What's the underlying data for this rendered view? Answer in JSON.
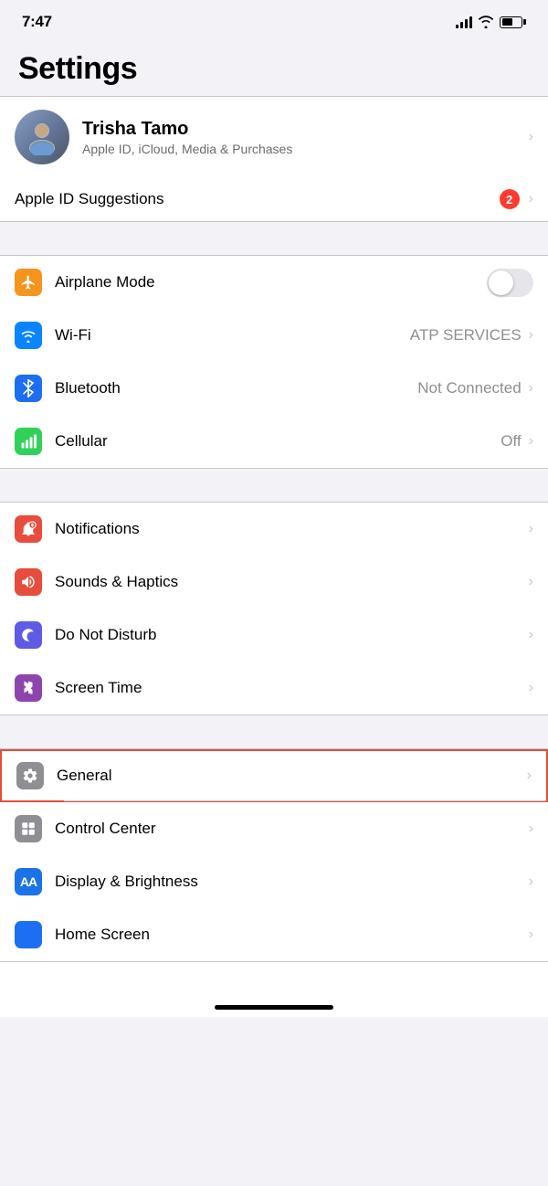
{
  "statusBar": {
    "time": "7:47",
    "batteryLevel": 55
  },
  "pageTitle": "Settings",
  "profile": {
    "name": "Trisha Tamo",
    "subtitle": "Apple ID, iCloud, Media & Purchases",
    "avatarEmoji": "👤"
  },
  "appleIdSuggestions": {
    "label": "Apple ID Suggestions",
    "badgeCount": "2"
  },
  "connectivity": [
    {
      "id": "airplane-mode",
      "label": "Airplane Mode",
      "iconBg": "bg-orange",
      "iconSymbol": "✈",
      "valueType": "toggle",
      "toggleOn": false
    },
    {
      "id": "wifi",
      "label": "Wi-Fi",
      "iconBg": "bg-blue",
      "iconSymbol": "wifi",
      "value": "ATP SERVICES",
      "valueType": "text"
    },
    {
      "id": "bluetooth",
      "label": "Bluetooth",
      "iconBg": "bg-bluetooth",
      "iconSymbol": "bluetooth",
      "value": "Not Connected",
      "valueType": "text"
    },
    {
      "id": "cellular",
      "label": "Cellular",
      "iconBg": "bg-cellular-green",
      "iconSymbol": "cellular",
      "value": "Off",
      "valueType": "text"
    }
  ],
  "notifications": [
    {
      "id": "notifications",
      "label": "Notifications",
      "iconBg": "bg-red-dark",
      "iconSymbol": "notifications"
    },
    {
      "id": "sounds-haptics",
      "label": "Sounds & Haptics",
      "iconBg": "bg-sound-red",
      "iconSymbol": "sound"
    },
    {
      "id": "do-not-disturb",
      "label": "Do Not Disturb",
      "iconBg": "bg-purple",
      "iconSymbol": "moon"
    },
    {
      "id": "screen-time",
      "label": "Screen Time",
      "iconBg": "bg-purple-dark",
      "iconSymbol": "hourglass"
    }
  ],
  "general": [
    {
      "id": "general",
      "label": "General",
      "iconBg": "bg-gray",
      "iconSymbol": "gear",
      "highlighted": true
    },
    {
      "id": "control-center",
      "label": "Control Center",
      "iconBg": "bg-gray",
      "iconSymbol": "toggles"
    },
    {
      "id": "display-brightness",
      "label": "Display & Brightness",
      "iconBg": "bg-blue-aa",
      "iconSymbol": "AA"
    },
    {
      "id": "home-screen",
      "label": "Home Screen",
      "iconBg": "bg-blue-grid",
      "iconSymbol": "grid"
    }
  ]
}
